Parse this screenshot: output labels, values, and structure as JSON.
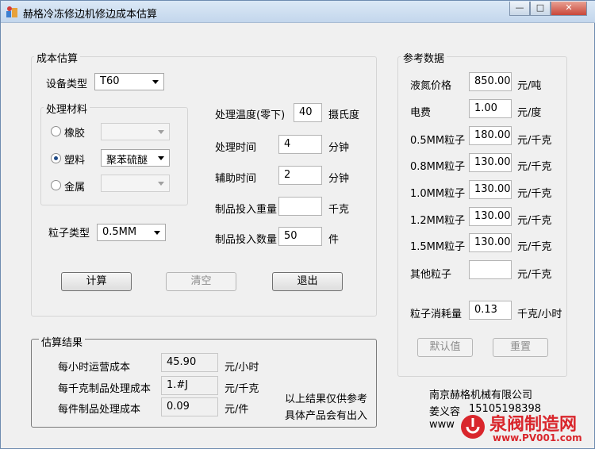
{
  "window": {
    "title": "赫格冷冻修边机修边成本估算"
  },
  "cost_group": {
    "title": "成本估算",
    "device_type_label": "设备类型",
    "device_type_value": "T60",
    "material_group_title": "处理材料",
    "rubber_label": "橡胶",
    "plastic_label": "塑料",
    "plastic_value": "聚苯硫醚",
    "metal_label": "金属",
    "particle_type_label": "粒子类型",
    "particle_type_value": "0.5MM",
    "temp_label": "处理温度(零下)",
    "temp_value": "40",
    "temp_unit": "摄氏度",
    "time_label": "处理时间",
    "time_value": "4",
    "time_unit": "分钟",
    "aux_time_label": "辅助时间",
    "aux_time_value": "2",
    "aux_time_unit": "分钟",
    "weight_label": "制品投入重量",
    "weight_value": "",
    "weight_unit": "千克",
    "qty_label": "制品投入数量",
    "qty_value": "50",
    "qty_unit": "件",
    "calc_button": "计算",
    "clear_button": "清空",
    "exit_button": "退出"
  },
  "result_group": {
    "title": "估算结果",
    "hourly_label": "每小时运营成本",
    "hourly_value": "45.90",
    "hourly_unit": "元/小时",
    "perkg_label": "每千克制品处理成本",
    "perkg_value": "1.#J",
    "perkg_unit": "元/千克",
    "perpiece_label": "每件制品处理成本",
    "perpiece_value": "0.09",
    "perpiece_unit": "元/件",
    "note_line1": "以上结果仅供参考",
    "note_line2": "具体产品会有出入"
  },
  "ref_group": {
    "title": "参考数据",
    "rows": [
      {
        "label": "液氮价格",
        "value": "850.00",
        "unit": "元/吨"
      },
      {
        "label": "电费",
        "value": "1.00",
        "unit": "元/度"
      },
      {
        "label": "0.5MM粒子",
        "value": "180.00",
        "unit": "元/千克"
      },
      {
        "label": "0.8MM粒子",
        "value": "130.00",
        "unit": "元/千克"
      },
      {
        "label": "1.0MM粒子",
        "value": "130.00",
        "unit": "元/千克"
      },
      {
        "label": "1.2MM粒子",
        "value": "130.00",
        "unit": "元/千克"
      },
      {
        "label": "1.5MM粒子",
        "value": "130.00",
        "unit": "元/千克"
      },
      {
        "label": "其他粒子",
        "value": "",
        "unit": "元/千克"
      }
    ],
    "consumption_label": "粒子消耗量",
    "consumption_value": "0.13",
    "consumption_unit": "千克/小时",
    "default_button": "默认值",
    "reset_button": "重置"
  },
  "company": {
    "name": "南京赫格机械有限公司",
    "contact": "姜义容",
    "phone": "15105198398",
    "web_prefix": "www"
  },
  "watermark": {
    "text": "泉阀制造网",
    "url": "www.PV001.com",
    "colors": {
      "brand": "#d9262c"
    }
  }
}
